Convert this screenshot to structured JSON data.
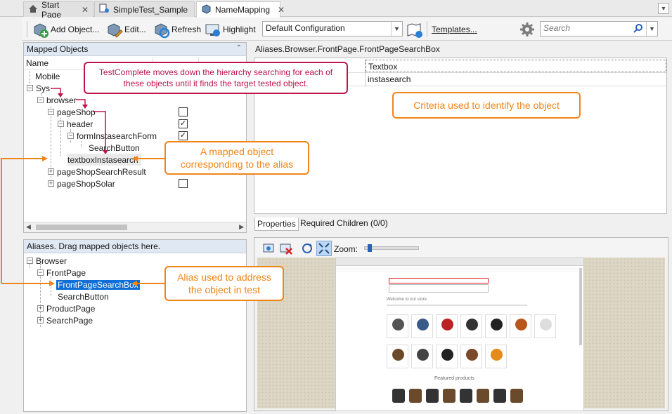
{
  "tabs": [
    {
      "label": "Start Page",
      "icon": "home-icon"
    },
    {
      "label": "SimpleTest_Sample",
      "icon": "project-icon"
    },
    {
      "label": "NameMapping",
      "icon": "namemapping-icon",
      "active": true
    }
  ],
  "toolbar": {
    "add_object": "Add Object...",
    "edit": "Edit...",
    "refresh": "Refresh",
    "highlight": "Highlight",
    "configuration": "Default Configuration",
    "templates": "Templates...",
    "search_placeholder": "Search"
  },
  "mapped_objects": {
    "title": "Mapped Objects",
    "column_name": "Name",
    "nodes": [
      {
        "label": "Mobile"
      },
      {
        "label": "Sys"
      },
      {
        "label": "browser"
      },
      {
        "label": "pageShop",
        "checked": false
      },
      {
        "label": "header",
        "checked": true
      },
      {
        "label": "formInstasearchForm",
        "checked": true
      },
      {
        "label": "SearchButton"
      },
      {
        "label": "textboxInstasearch"
      },
      {
        "label": "pageShopSearchResult"
      },
      {
        "label": "pageShopSolar",
        "checked": false
      }
    ]
  },
  "aliases": {
    "title": "Aliases. Drag mapped objects here.",
    "nodes": [
      {
        "label": "Browser"
      },
      {
        "label": "FrontPage"
      },
      {
        "label": "FrontPageSearchBox",
        "selected": true
      },
      {
        "label": "SearchButton"
      },
      {
        "label": "ProductPage"
      },
      {
        "label": "SearchPage"
      }
    ]
  },
  "properties": {
    "path": "Aliases.Browser.FrontPage.FrontPageSearchBox",
    "rows": [
      {
        "value": "Textbox"
      },
      {
        "value": "instasearch"
      }
    ],
    "tabs": [
      "Properties",
      "Required Children (0/0)"
    ]
  },
  "preview": {
    "zoom_label": "Zoom:",
    "zoom_fraction": 0.05,
    "store_heading": "Welcome to our store",
    "featured_heading": "Featured products"
  },
  "callouts": {
    "hierarchy": "TestComplete moves down the hierarchy searching for each of these objects until it finds the target tested object.",
    "criteria": "Criteria used to identify the object",
    "mapped_object": "A mapped object corresponding to the alias",
    "alias": "Alias used to address the object in test"
  },
  "colors": {
    "callout_orange": "#f08519",
    "callout_red": "#c0134a",
    "selection": "#0f6ed6"
  }
}
